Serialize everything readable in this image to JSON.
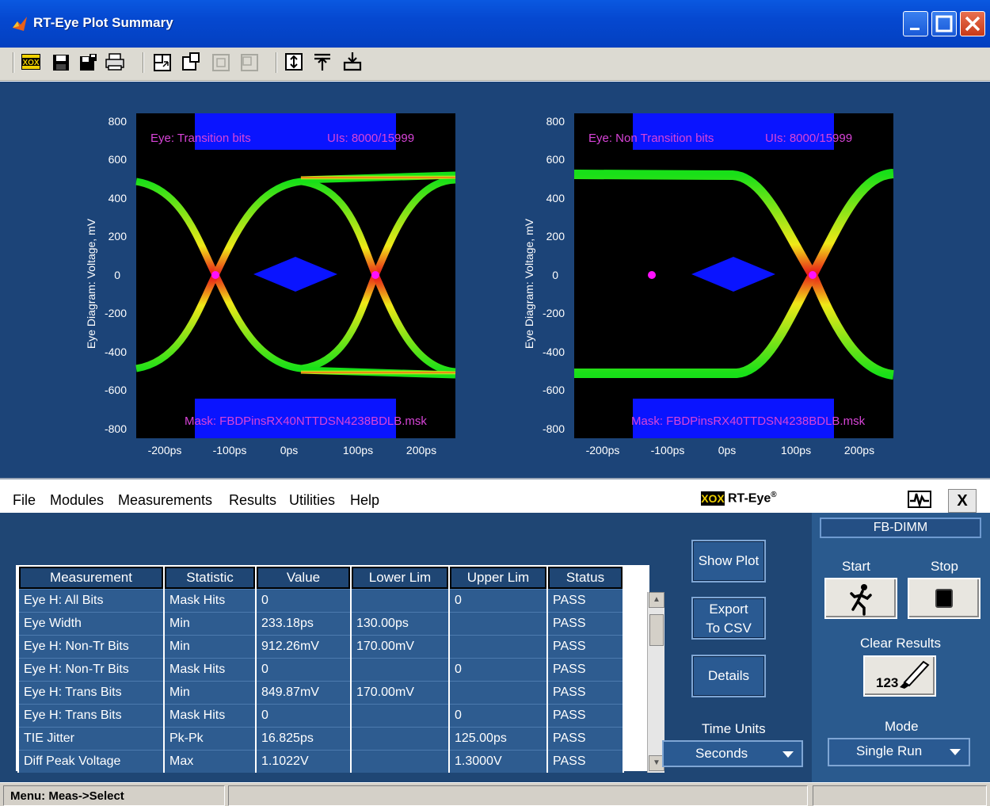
{
  "window": {
    "title": "RT-Eye Plot Summary"
  },
  "toolbar": {
    "icons": [
      "rt-eye-icon",
      "save-icon",
      "save-all-icon",
      "print-icon",
      "tile-icon",
      "cascade-icon",
      "dock-icon",
      "undock-icon",
      "fit-icon",
      "move-up-icon",
      "move-down-icon"
    ]
  },
  "plots": [
    {
      "title": "Eye: Transition bits",
      "uis": "UIs: 8000/15999",
      "mask": "Mask: FBDPinsRX40NTTDSN4238BDLB.msk",
      "ylabel": "Eye Diagram: Voltage, mV"
    },
    {
      "title": "Eye: Non Transition bits",
      "uis": "UIs: 8000/15999",
      "mask": "Mask: FBDPinsRX40TTDSN4238BDLB.msk",
      "ylabel": "Eye Diagram: Voltage, mV"
    }
  ],
  "axes": {
    "y_ticks": [
      "800",
      "600",
      "400",
      "200",
      "0",
      "-200",
      "-400",
      "-600",
      "-800"
    ],
    "x_ticks": [
      "-200ps",
      "-100ps",
      "0ps",
      "100ps",
      "200ps"
    ]
  },
  "menu": {
    "items": [
      "File",
      "Modules",
      "Measurements",
      "Results",
      "Utilities",
      "Help"
    ],
    "brand": "RT-Eye",
    "brand_logo": "XOX",
    "close": "X"
  },
  "table": {
    "headers": [
      "Measurement",
      "Statistic",
      "Value",
      "Lower Lim",
      "Upper Lim",
      "Status"
    ],
    "rows": [
      [
        "Eye H: All Bits",
        "Mask Hits",
        "0",
        "",
        "0",
        "PASS"
      ],
      [
        "Eye Width",
        "Min",
        "233.18ps",
        "130.00ps",
        "",
        "PASS"
      ],
      [
        "Eye H: Non-Tr Bits",
        "Min",
        "912.26mV",
        "170.00mV",
        "",
        "PASS"
      ],
      [
        "Eye H: Non-Tr Bits",
        "Mask Hits",
        "0",
        "",
        "0",
        "PASS"
      ],
      [
        "Eye H: Trans Bits",
        "Min",
        "849.87mV",
        "170.00mV",
        "",
        "PASS"
      ],
      [
        "Eye H: Trans Bits",
        "Mask Hits",
        "0",
        "",
        "0",
        "PASS"
      ],
      [
        "TIE Jitter",
        "Pk-Pk",
        "16.825ps",
        "",
        "125.00ps",
        "PASS"
      ],
      [
        "Diff Peak Voltage",
        "Max",
        "1.1022V",
        "",
        "1.3000V",
        "PASS"
      ]
    ]
  },
  "buttons": {
    "show_plot": "Show Plot",
    "export_line1": "Export",
    "export_line2": "To CSV",
    "details": "Details"
  },
  "time_units": {
    "label": "Time Units",
    "value": "Seconds"
  },
  "right_panel": {
    "technology": "FB-DIMM",
    "start": "Start",
    "stop": "Stop",
    "clear": "Clear Results",
    "clear_icon_text": "123",
    "mode_label": "Mode",
    "mode_value": "Single Run"
  },
  "status": {
    "text": "Menu: Meas->Select"
  },
  "colors": {
    "plot_bg": "#1c4478",
    "panel_bg": "#1f4674",
    "mask": "#0a14ff",
    "marker": "#ff10ff"
  }
}
